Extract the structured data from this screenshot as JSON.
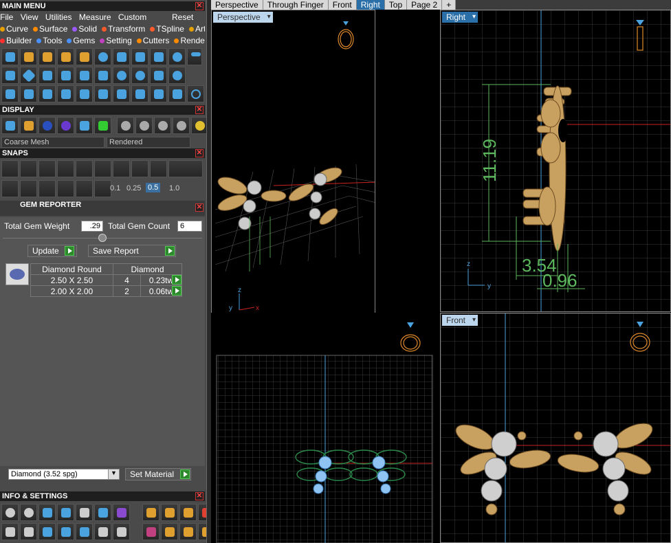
{
  "main_menu": {
    "title": "MAIN MENU",
    "menus": [
      "File",
      "View",
      "Utilities",
      "Measure",
      "Custom"
    ],
    "reset": "Reset",
    "row2": [
      {
        "label": "Curve",
        "color": "#e6a000"
      },
      {
        "label": "Surface",
        "color": "#ff8c00"
      },
      {
        "label": "Solid",
        "color": "#9b59ff"
      },
      {
        "label": "Transform",
        "color": "#ff5a2a"
      },
      {
        "label": "TSpline",
        "color": "#ff5a2a"
      },
      {
        "label": "Art",
        "color": "#e6a000"
      }
    ],
    "row3": [
      {
        "label": "Builder",
        "color": "#ff3030"
      },
      {
        "label": "Tools",
        "color": "#4a90ff"
      },
      {
        "label": "Gems",
        "color": "#4a90ff"
      },
      {
        "label": "Setting",
        "color": "#c040c0"
      },
      {
        "label": "Cutters",
        "color": "#ff8c00"
      },
      {
        "label": "Render",
        "color": "#ff8c00"
      }
    ]
  },
  "display": {
    "title": "DISPLAY",
    "mesh_select": "Coarse Mesh",
    "render_select": "Rendered"
  },
  "snaps": {
    "title": "SNAPS",
    "values": [
      "0.1",
      "0.25",
      "0.5",
      "1.0"
    ]
  },
  "gem_reporter": {
    "title": "GEM REPORTER",
    "total_weight_label": "Total Gem Weight",
    "total_weight": ".29",
    "total_count_label": "Total Gem Count",
    "total_count": "6",
    "update_label": "Update",
    "save_label": "Save Report",
    "table_header": [
      "Diamond Round",
      "Diamond"
    ],
    "rows": [
      {
        "size": "2.50 X 2.50",
        "count": "4",
        "weight": "0.23tw"
      },
      {
        "size": "2.00 X 2.00",
        "count": "2",
        "weight": "0.06tw"
      }
    ],
    "material_select": "Diamond    (3.52 spg)",
    "set_material": "Set Material"
  },
  "info": {
    "title": "INFO & SETTINGS"
  },
  "tabs": [
    "Perspective",
    "Through Finger",
    "Front",
    "Right",
    "Top",
    "Page 2",
    "+"
  ],
  "active_tab": "Right",
  "viewports": {
    "perspective": "Perspective",
    "right": "Right",
    "front": "Front"
  },
  "dimensions": {
    "height": "11.19",
    "width1": "3.54",
    "width2": "0.96"
  },
  "axes": {
    "x": "x",
    "y": "y",
    "z": "z"
  }
}
